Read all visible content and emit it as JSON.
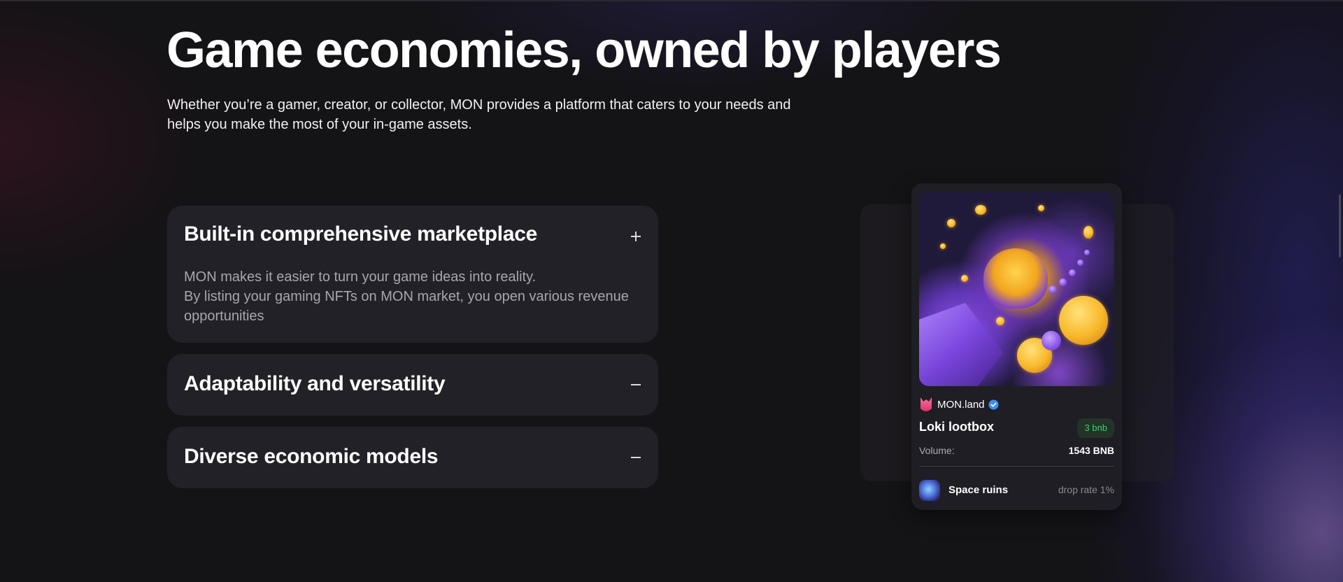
{
  "hero": {
    "title": "Game economies, owned by players",
    "subtitle": "Whether you’re a gamer, creator, or collector, MON provides a platform that caters to your needs and helps you make the most of your in-game assets."
  },
  "accordion": {
    "items": [
      {
        "title": "Built-in comprehensive marketplace",
        "expanded": true,
        "toggle_icon": "plus-icon",
        "body_line1": "MON makes it easier to turn your game ideas into reality.",
        "body_line2": "By listing your gaming NFTs on MON market, you open various revenue opportunities"
      },
      {
        "title": "Adaptability and versatility",
        "expanded": false,
        "toggle_icon": "minus-icon"
      },
      {
        "title": "Diverse economic models",
        "expanded": false,
        "toggle_icon": "minus-icon"
      }
    ]
  },
  "nft_card": {
    "creator": "MON.land",
    "verified_icon": "verified-badge-icon",
    "title": "Loki lootbox",
    "price": "3 bnb",
    "volume_label": "Volume:",
    "volume_value": "1543 BNB",
    "drop": {
      "name": "Space ruins",
      "rate": "drop rate 1%"
    }
  },
  "colors": {
    "background": "#141316",
    "panel": "#222127",
    "price_green": "#3ecf70",
    "verified_blue": "#3d8ef0",
    "accent_purple": "#7a46e0"
  }
}
